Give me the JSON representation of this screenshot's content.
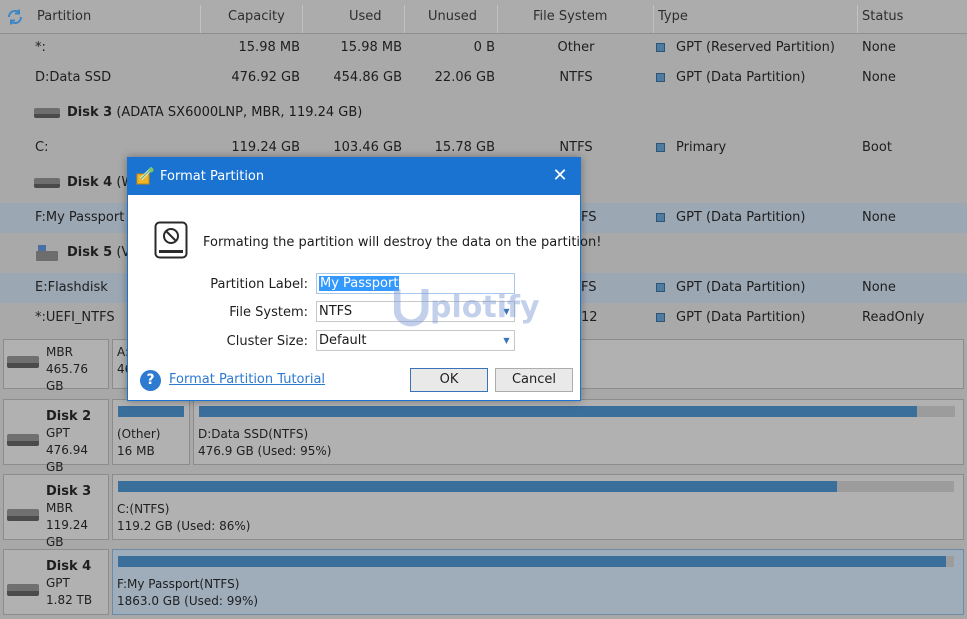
{
  "table": {
    "refresh_icon": "refresh-icon",
    "columns": [
      "Partition",
      "Capacity",
      "Used",
      "Unused",
      "File System",
      "Type",
      "Status"
    ],
    "rows": [
      {
        "partition": "*:",
        "capacity": "15.98 MB",
        "used": "15.98 MB",
        "unused": "0 B",
        "fs": "Other",
        "type": "GPT (Reserved Partition)",
        "status": "None"
      },
      {
        "partition": "D:Data SSD",
        "capacity": "476.92 GB",
        "used": "454.86 GB",
        "unused": "22.06 GB",
        "fs": "NTFS",
        "type": "GPT (Data Partition)",
        "status": "None"
      }
    ],
    "disk3": {
      "name": "Disk 3",
      "detail": "(ADATA SX6000LNP, MBR, 119.24 GB)"
    },
    "disk3_rows": [
      {
        "partition": "C:",
        "capacity": "119.24 GB",
        "used": "103.46 GB",
        "unused": "15.78 GB",
        "fs": "NTFS",
        "type": "Primary",
        "status": "Boot"
      }
    ],
    "disk4": {
      "name": "Disk 4",
      "detail": "(WD"
    },
    "disk4_rows": [
      {
        "partition": "F:My Passport",
        "fs": "FS",
        "type": "GPT (Data Partition)",
        "status": "None"
      }
    ],
    "disk5": {
      "name": "Disk 5",
      "detail": "(Ve"
    },
    "disk5_rows": [
      {
        "partition": "E:Flashdisk",
        "fs": "FS",
        "type": "GPT (Data Partition)",
        "status": "None"
      },
      {
        "partition": "*:UEFI_NTFS",
        "fs": "12",
        "type": "GPT (Data Partition)",
        "status": "ReadOnly"
      }
    ]
  },
  "map": {
    "disk1": {
      "name": "",
      "scheme": "MBR",
      "size": "465.76 GB",
      "p1": "A:",
      "p1b": "46"
    },
    "disk2": {
      "name": "Disk 2",
      "scheme": "GPT",
      "size": "476.94 GB",
      "p1_name": "(Other)",
      "p1_info": "16 MB",
      "p1_usage": 1.0,
      "p2_name": "D:Data SSD(NTFS)",
      "p2_info": "476.9 GB (Used: 95%)",
      "p2_usage": 0.95
    },
    "disk3": {
      "name": "Disk 3",
      "scheme": "MBR",
      "size": "119.24 GB",
      "p1_name": "C:(NTFS)",
      "p1_info": "119.2 GB (Used: 86%)",
      "p1_usage": 0.86
    },
    "disk4": {
      "name": "Disk 4",
      "scheme": "GPT",
      "size": "1.82 TB",
      "p1_name": "F:My Passport(NTFS)",
      "p1_info": "1863.0 GB (Used: 99%)",
      "p1_usage": 0.99
    }
  },
  "dialog": {
    "title": "Format Partition",
    "close": "✕",
    "warning": "Formating the partition will destroy the data on the partition!",
    "label_label": "Partition Label:",
    "label_value": "My Passport",
    "fs_label": "File System:",
    "fs_value": "NTFS",
    "cluster_label": "Cluster Size:",
    "cluster_value": "Default",
    "help_link": "Format Partition Tutorial",
    "ok": "OK",
    "cancel": "Cancel"
  },
  "watermark": "plotify",
  "colors": {
    "accent": "#1a73d1",
    "bar_fill": "#3a6e9b",
    "selected_row": "#9ba7b3"
  }
}
